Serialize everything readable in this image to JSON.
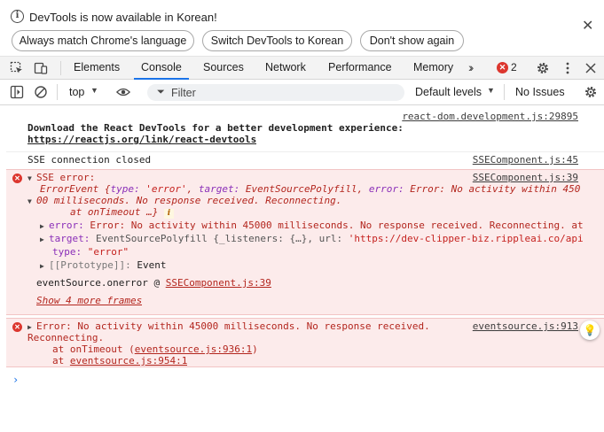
{
  "infobar": {
    "message": "DevTools is now available in Korean!",
    "buttons": [
      "Always match Chrome's language",
      "Switch DevTools to Korean",
      "Don't show again"
    ]
  },
  "tabs": [
    "Elements",
    "Console",
    "Sources",
    "Network",
    "Performance",
    "Memory"
  ],
  "active_tab": "Console",
  "error_count": "2",
  "toolbar": {
    "context": "top",
    "filter_placeholder": "Filter",
    "levels": "Default levels",
    "issues": "No Issues"
  },
  "console": {
    "react_devtools": {
      "source": "react-dom.development.js:29895",
      "line1": "Download the React DevTools for a better development experience:",
      "link": "https://reactjs.org/link/react-devtools"
    },
    "sse_closed": {
      "text": "SSE connection closed",
      "source": "SSEComponent.js:45"
    },
    "sse_error": {
      "source": "SSEComponent.js:39",
      "header": "SSE error:",
      "event_prefix": "ErrorEvent {",
      "type_key": "type:",
      "type_val": "'error'",
      "target_key": "target:",
      "target_val": "EventSourcePolyfill,",
      "error_key": "error:",
      "error_val": "Error: No activity within 450",
      "cont1": "00 milliseconds. No response received. Reconnecting.",
      "cont2": "at onTimeout …}",
      "error_prop_key": "error:",
      "error_prop_val": "Error: No activity within 45000 milliseconds. No response received. Reconnecting. at",
      "target_prop_key": "target:",
      "target_prop_val": "EventSourcePolyfill {_listeners: {…}, url: ",
      "target_prop_url": "'https://dev-clipper-biz.rippleai.co/api",
      "type_prop_key": "type:",
      "type_prop_val": "\"error\"",
      "proto_key": "[[Prototype]]:",
      "proto_val": "Event",
      "stack_prefix": "eventSource.onerror @ ",
      "stack_link": "SSEComponent.js:39",
      "more_frames": "Show 4 more frames"
    },
    "timeout_error": {
      "source": "eventsource.js:913",
      "line1": "Error: No activity within 45000 milliseconds. No response received.",
      "line2": "Reconnecting.",
      "at1_prefix": "at onTimeout (",
      "at1_link": "eventsource.js:936:1",
      "at1_suffix": ")",
      "at2_prefix": "at ",
      "at2_link": "eventsource.js:954:1"
    },
    "prompt": "›"
  }
}
